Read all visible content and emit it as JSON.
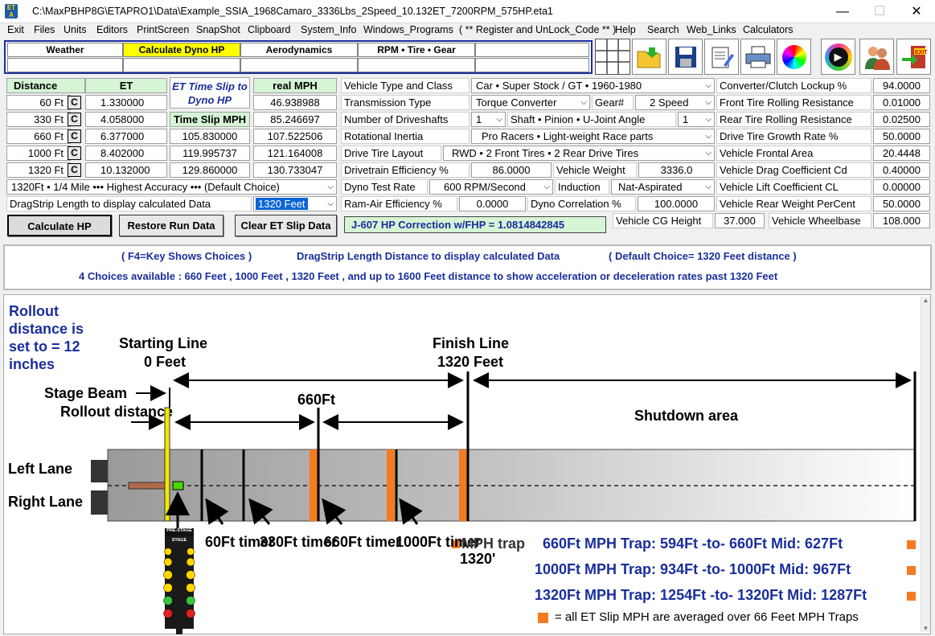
{
  "window": {
    "title": "C:\\MaxPBHP8G\\ETAPRO1\\Data\\Example_SSIA_1968Camaro_3336Lbs_2Speed_10.132ET_7200RPM_575HP.eta1",
    "icon_text": "ET A",
    "minimize": "—",
    "maximize": "☐",
    "close": "✕"
  },
  "menu": [
    "Exit",
    "Files",
    "Units",
    "Editors",
    "PrintScreen",
    "SnapShot",
    "Clipboard",
    "System_Info",
    "Windows_Programs",
    "( ** Register and UnLock_Code ** )",
    "Help",
    "Search",
    "Web_Links",
    "Calculators"
  ],
  "tabs": [
    "Weather",
    "Calculate Dyno HP",
    "Aerodynamics",
    "RPM  •  Tire  •  Gear"
  ],
  "grid": {
    "h_distance": "Distance",
    "h_et": "ET",
    "h_et_slip": "ET Time Slip to Dyno HP",
    "h_real_mph": "real  MPH",
    "h_timeslip_mph": "Time Slip MPH",
    "rows": [
      {
        "dist": "60 Ft",
        "c": "C",
        "et": "1.330000",
        "slip_mph": "",
        "real_mph": "46.938988"
      },
      {
        "dist": "330 Ft",
        "c": "C",
        "et": "4.058000",
        "slip_mph": "",
        "real_mph": "85.246697"
      },
      {
        "dist": "660 Ft",
        "c": "C",
        "et": "6.377000",
        "slip_mph": "105.830000",
        "real_mph": "107.522506"
      },
      {
        "dist": "1000 Ft",
        "c": "C",
        "et": "8.402000",
        "slip_mph": "119.995737",
        "real_mph": "121.164008"
      },
      {
        "dist": "1320 Ft",
        "c": "C",
        "et": "10.132000",
        "slip_mph": "129.860000",
        "real_mph": "130.733047"
      }
    ],
    "accuracy": "1320Ft • 1/4 Mile ••• Highest Accuracy ••• (Default Choice)",
    "dragstrip_label": "DragStrip Length to display calculated Data",
    "dragstrip_value": "1320 Feet",
    "btn_calc": "Calculate  HP",
    "btn_restore": "Restore Run Data",
    "btn_clear": "Clear ET Slip Data"
  },
  "vehicle": {
    "type_label": "Vehicle Type and Class",
    "type_value": "Car  •  Super Stock / GT  •  1960-1980",
    "trans_label": "Transmission Type",
    "trans_value": "Torque Converter",
    "gear_label": "Gear#",
    "gear_value": "2  Speed",
    "drive_label": "Number of Driveshafts",
    "drive_value": "1",
    "angle_label": "Shaft • Pinion • U-Joint Angle",
    "angle_value": "1",
    "inertia_label": "Rotational Inertia",
    "inertia_value": "Pro Racers  •  Light-weight Race parts",
    "layout_label": "Drive Tire Layout",
    "layout_value": "RWD • 2  Front Tires  •  2  Rear Drive Tires",
    "eff_label": "Drivetrain Efficiency %",
    "eff_value": "86.0000",
    "weight_label": "Vehicle Weight",
    "weight_value": "3336.0",
    "dyno_label": "Dyno Test Rate",
    "dyno_value": "600 RPM/Second",
    "induction_label": "Induction",
    "induction_value": "Nat-Aspirated",
    "ram_label": "Ram-Air Efficiency %",
    "ram_value": "0.0000",
    "corr_label": "Dyno Correlation %",
    "corr_value": "100.0000",
    "j607": "J-607 HP Correction w/FHP = 1.0814842845",
    "cg_label": "Vehicle CG Height",
    "cg_value": "37.000",
    "wb_label": "Vehicle Wheelbase",
    "wb_value": "108.000"
  },
  "right": [
    {
      "label": "Converter/Clutch Lockup %",
      "value": "94.0000"
    },
    {
      "label": "Front Tire Rolling Resistance",
      "value": "0.01000"
    },
    {
      "label": "Rear Tire Rolling Resistance",
      "value": "0.02500"
    },
    {
      "label": "Drive Tire Growth Rate %",
      "value": "50.0000"
    },
    {
      "label": "Vehicle Frontal Area",
      "value": "20.4448"
    },
    {
      "label": "Vehicle Drag Coefficient  Cd",
      "value": "0.40000"
    },
    {
      "label": "Vehicle Lift Coefficient    CL",
      "value": "0.00000"
    },
    {
      "label": "Vehicle Rear Weight PerCent",
      "value": "50.0000"
    }
  ],
  "info": {
    "line1a": "( F4=Key Shows Choices )",
    "line1b": "DragStrip Length Distance to display calculated Data",
    "line1c": "( Default Choice= 1320 Feet distance )",
    "line2": "4 Choices available :   660 Feet , 1000 Feet  , 1320 Feet ,  and up to 1600 Feet distance to show acceleration or deceleration rates past 1320 Feet"
  },
  "diagram": {
    "rollout": "Rollout distance is set to = 12 inches",
    "start_line": "Starting Line",
    "start_feet": "0 Feet",
    "finish_line": "Finish Line",
    "finish_feet": "1320 Feet",
    "stage_beam": "Stage Beam",
    "rollout_dist": "Rollout distance",
    "mid": "660Ft",
    "shutdown": "Shutdown area",
    "left_lane": "Left Lane",
    "right_lane": "Right Lane",
    "t60": "60Ft timer",
    "t330": "330Ft timer",
    "t660": "660Ft timer",
    "t1000": "1000Ft timer",
    "mph_trap": "MPH trap",
    "trap_1320": "1320'",
    "prestage": "PRE-STAGE",
    "stage": "STAGE",
    "trap660": "660Ft MPH Trap:    594Ft -to- 660Ft      Mid:   627Ft",
    "trap1000": "1000Ft MPH Trap:    934Ft -to- 1000Ft    Mid:   967Ft",
    "trap1320": "1320Ft MPH Trap: 1254Ft -to- 1320Ft   Mid: 1287Ft",
    "legend": "=  all ET Slip MPH are averaged over 66 Feet MPH Traps",
    "colors": {
      "trap": "#f47b20",
      "title": "#1a2e9c"
    }
  }
}
